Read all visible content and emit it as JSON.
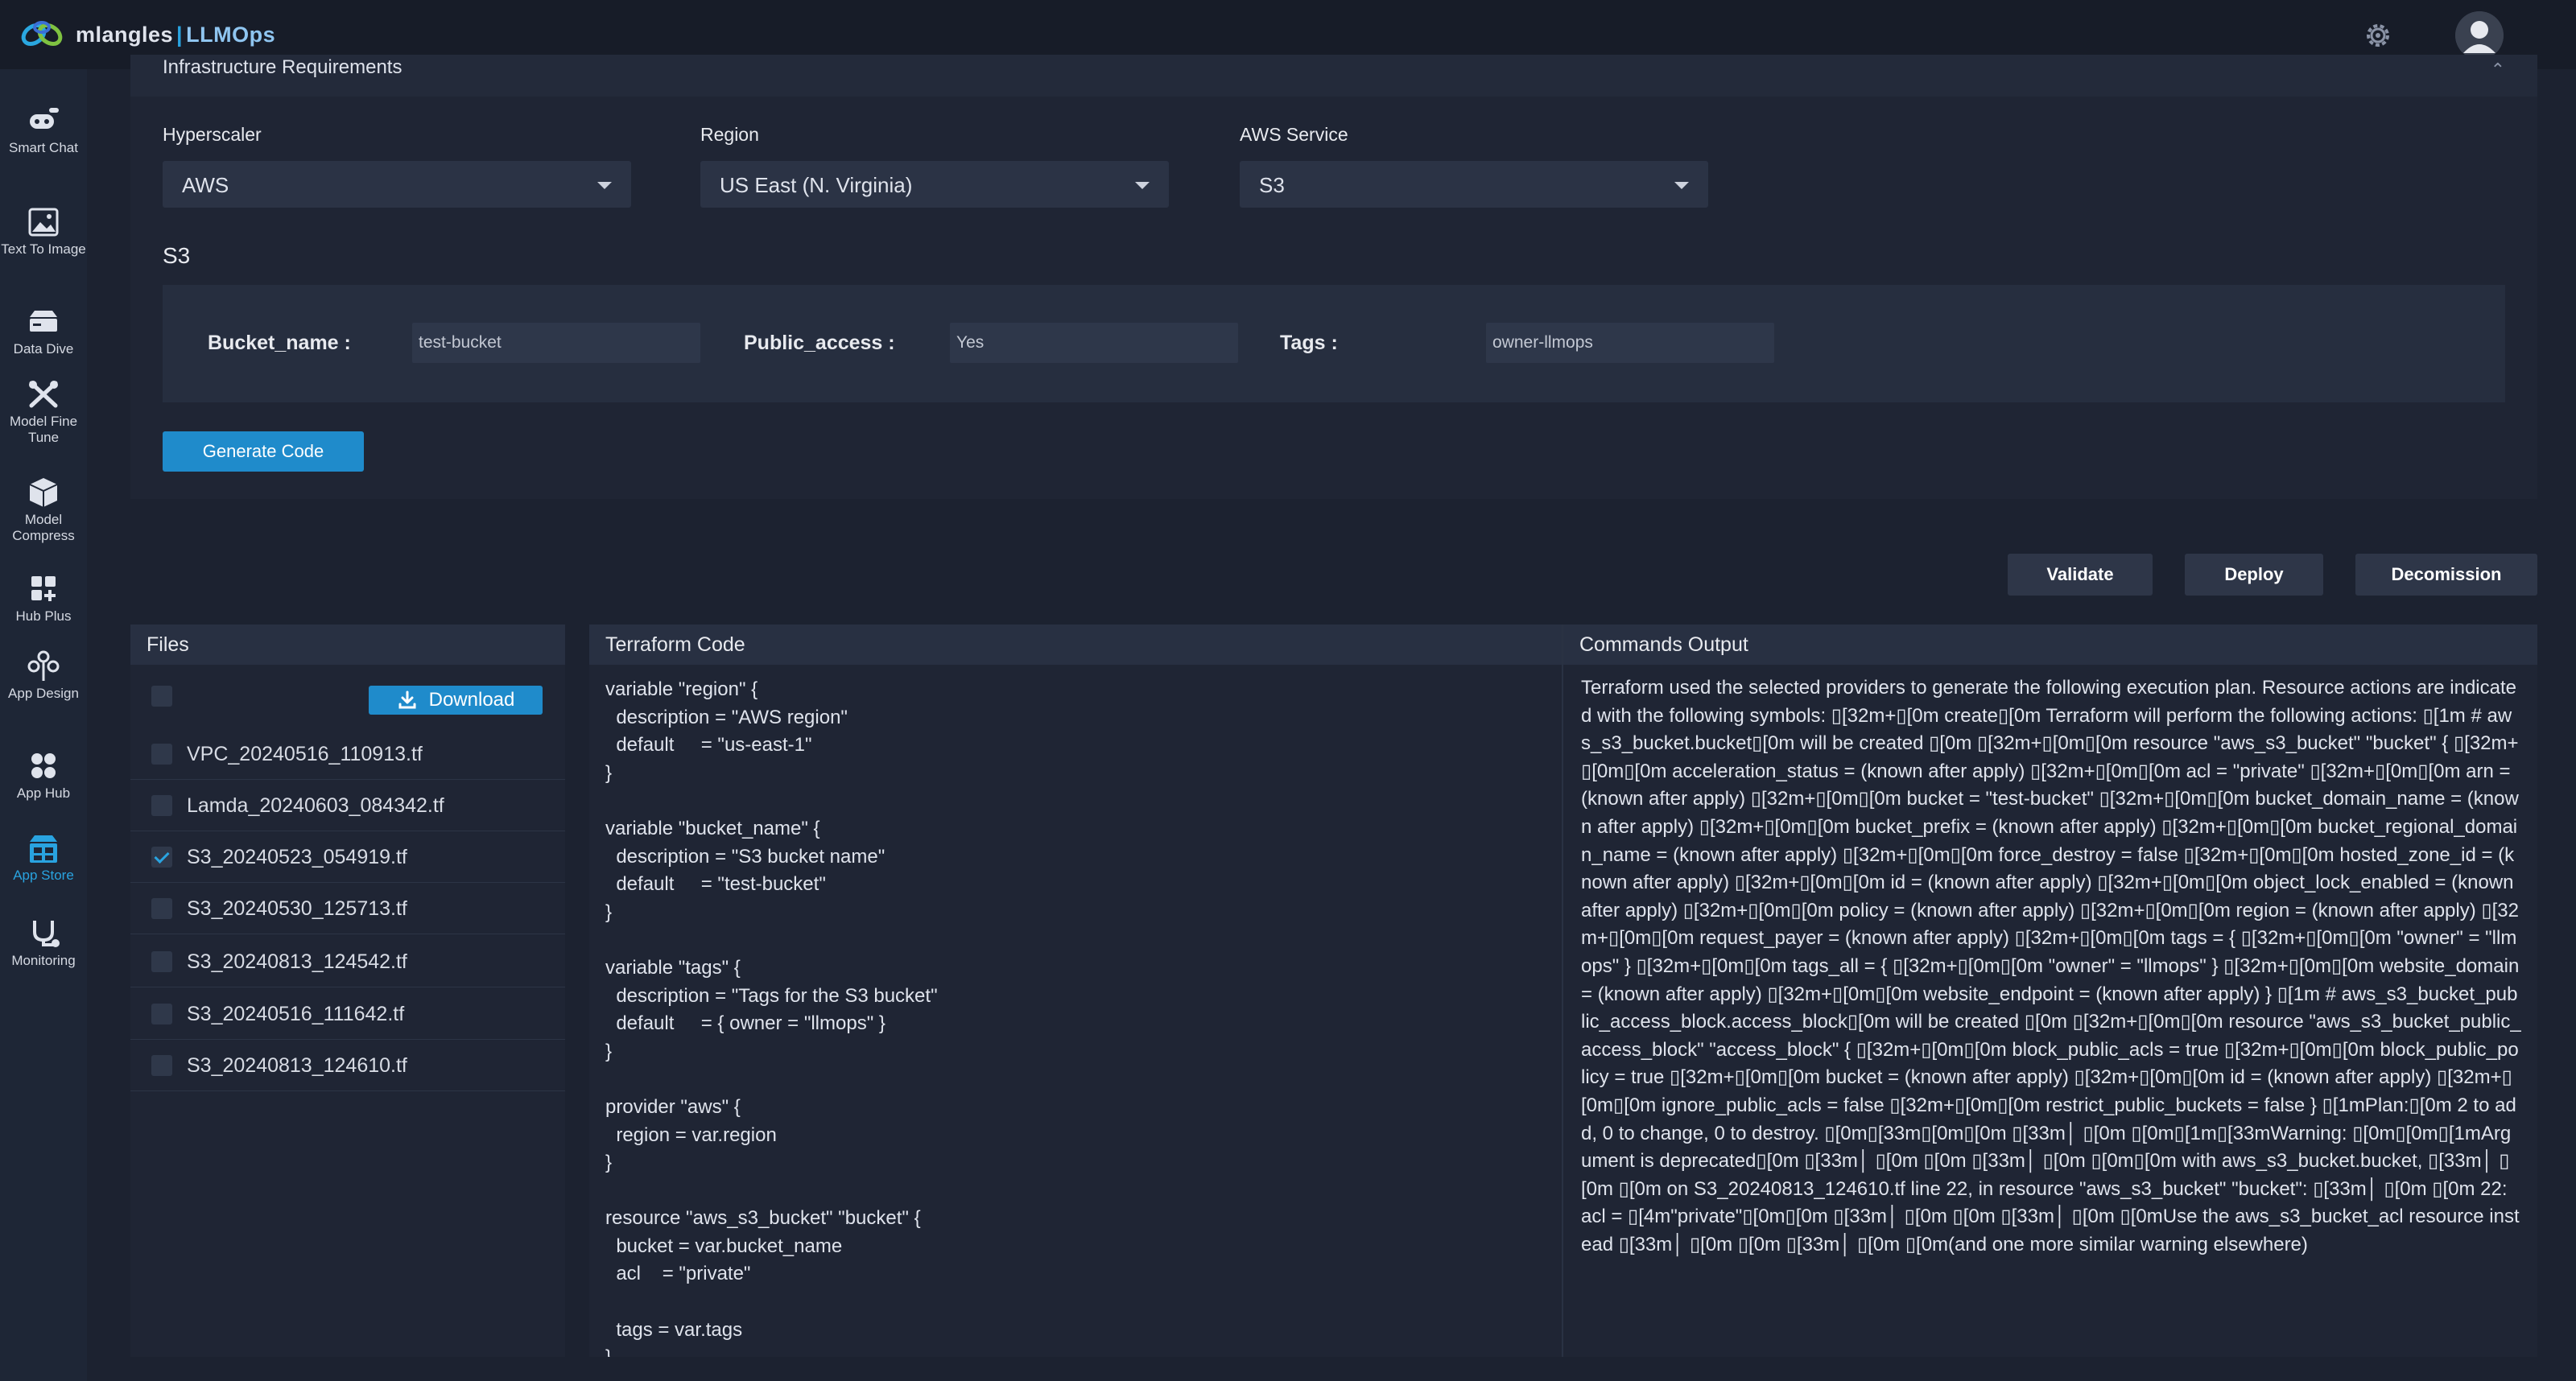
{
  "app": {
    "logo_text": "mlangles",
    "logo_brand": "LLMOps",
    "logo_separator": "|"
  },
  "sidebar": {
    "items": [
      {
        "label": "Smart Chat",
        "icon": "smart-chat-icon"
      },
      {
        "label": "Text To Image",
        "icon": "text-to-image-icon"
      },
      {
        "label": "Data Dive",
        "icon": "data-dive-icon"
      },
      {
        "label": "Model Fine Tune",
        "icon": "model-fine-tune-icon"
      },
      {
        "label": "Model Compress",
        "icon": "model-compress-icon"
      },
      {
        "label": "Hub Plus",
        "icon": "hub-plus-icon"
      },
      {
        "label": "App Design",
        "icon": "app-design-icon"
      },
      {
        "label": "App Hub",
        "icon": "app-hub-icon"
      },
      {
        "label": "App Store",
        "icon": "app-store-icon",
        "active": true
      },
      {
        "label": "Monitoring",
        "icon": "monitoring-icon"
      }
    ]
  },
  "config": {
    "section_title": "Infrastructure Requirements",
    "hyperscaler": {
      "label": "Hyperscaler",
      "value": "AWS"
    },
    "region": {
      "label": "Region",
      "value": "US East (N. Virginia)"
    },
    "service": {
      "label": "AWS Service",
      "value": "S3"
    },
    "service_title": "S3",
    "params": {
      "bucket_name": {
        "label": "Bucket_name :",
        "value": "test-bucket"
      },
      "public_access": {
        "label": "Public_access :",
        "value": "Yes"
      },
      "tags": {
        "label": "Tags :",
        "value": "owner-llmops"
      }
    },
    "generate_button": "Generate Code"
  },
  "actions": {
    "validate": "Validate",
    "deploy": "Deploy",
    "decommission": "Decomission"
  },
  "files": {
    "title": "Files",
    "download_label": "Download",
    "items": [
      {
        "name": "VPC_20240516_110913.tf",
        "checked": false
      },
      {
        "name": "Lamda_20240603_084342.tf",
        "checked": false
      },
      {
        "name": "S3_20240523_054919.tf",
        "checked": true
      },
      {
        "name": "S3_20240530_125713.tf",
        "checked": false
      },
      {
        "name": "S3_20240813_124542.tf",
        "checked": false
      },
      {
        "name": "S3_20240516_111642.tf",
        "checked": false
      },
      {
        "name": "S3_20240813_124610.tf",
        "checked": false
      }
    ]
  },
  "terraform": {
    "title": "Terraform Code",
    "code": "variable \"region\" {\n  description = \"AWS region\"\n  default     = \"us-east-1\"\n}\n\nvariable \"bucket_name\" {\n  description = \"S3 bucket name\"\n  default     = \"test-bucket\"\n}\n\nvariable \"tags\" {\n  description = \"Tags for the S3 bucket\"\n  default     = { owner = \"llmops\" }\n}\n\nprovider \"aws\" {\n  region = var.region\n}\n\nresource \"aws_s3_bucket\" \"bucket\" {\n  bucket = var.bucket_name\n  acl    = \"private\"\n\n  tags = var.tags\n}"
  },
  "output": {
    "title": "Commands Output",
    "text": "Terraform used the selected providers to generate the following execution plan. Resource actions are indicated with the following symbols: ▯[32m+▯[0m create▯[0m Terraform will perform the following actions: ▯[1m # aws_s3_bucket.bucket▯[0m will be created ▯[0m ▯[32m+▯[0m▯[0m resource \"aws_s3_bucket\" \"bucket\" { ▯[32m+▯[0m▯[0m acceleration_status = (known after apply) ▯[32m+▯[0m▯[0m acl = \"private\" ▯[32m+▯[0m▯[0m arn = (known after apply) ▯[32m+▯[0m▯[0m bucket = \"test-bucket\" ▯[32m+▯[0m▯[0m bucket_domain_name = (known after apply) ▯[32m+▯[0m▯[0m bucket_prefix = (known after apply) ▯[32m+▯[0m▯[0m bucket_regional_domain_name = (known after apply) ▯[32m+▯[0m▯[0m force_destroy = false ▯[32m+▯[0m▯[0m hosted_zone_id = (known after apply) ▯[32m+▯[0m▯[0m id = (known after apply) ▯[32m+▯[0m▯[0m object_lock_enabled = (known after apply) ▯[32m+▯[0m▯[0m policy = (known after apply) ▯[32m+▯[0m▯[0m region = (known after apply) ▯[32m+▯[0m▯[0m request_payer = (known after apply) ▯[32m+▯[0m▯[0m tags = { ▯[32m+▯[0m▯[0m \"owner\" = \"llmops\" } ▯[32m+▯[0m▯[0m tags_all = { ▯[32m+▯[0m▯[0m \"owner\" = \"llmops\" } ▯[32m+▯[0m▯[0m website_domain = (known after apply) ▯[32m+▯[0m▯[0m website_endpoint = (known after apply) } ▯[1m # aws_s3_bucket_public_access_block.access_block▯[0m will be created ▯[0m ▯[32m+▯[0m▯[0m resource \"aws_s3_bucket_public_access_block\" \"access_block\" { ▯[32m+▯[0m▯[0m block_public_acls = true ▯[32m+▯[0m▯[0m block_public_policy = true ▯[32m+▯[0m▯[0m bucket = (known after apply) ▯[32m+▯[0m▯[0m id = (known after apply) ▯[32m+▯[0m▯[0m ignore_public_acls = false ▯[32m+▯[0m▯[0m restrict_public_buckets = false } ▯[1mPlan:▯[0m 2 to add, 0 to change, 0 to destroy. ▯[0m▯[33m▯[0m▯[0m ▯[33m│ ▯[0m ▯[0m▯[1m▯[33mWarning: ▯[0m▯[0m▯[1mArgument is deprecated▯[0m ▯[33m│ ▯[0m ▯[0m ▯[33m│ ▯[0m ▯[0m▯[0m with aws_s3_bucket.bucket, ▯[33m│ ▯[0m ▯[0m on S3_20240813_124610.tf line 22, in resource \"aws_s3_bucket\" \"bucket\": ▯[33m│ ▯[0m ▯[0m 22: acl = ▯[4m\"private\"▯[0m▯[0m ▯[33m│ ▯[0m ▯[0m ▯[33m│ ▯[0m ▯[0mUse the aws_s3_bucket_acl resource instead ▯[33m│ ▯[0m ▯[0m ▯[33m│ ▯[0m ▯[0m(and one more similar warning elsewhere)"
  }
}
